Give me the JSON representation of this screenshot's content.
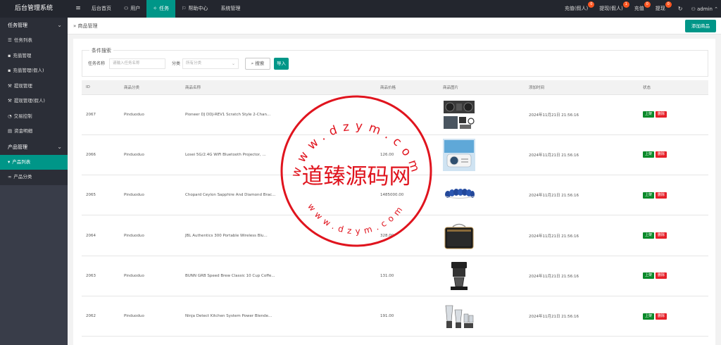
{
  "app": {
    "title": "后台管理系统"
  },
  "topnav": {
    "items": [
      {
        "label": "后台首页",
        "icon": "home-icon"
      },
      {
        "label": "用户",
        "icon": "user-icon"
      },
      {
        "label": "任务",
        "icon": "run-icon"
      },
      {
        "label": "帮助中心",
        "icon": "flag-icon"
      },
      {
        "label": "系统管理",
        "icon": ""
      }
    ],
    "active": "任务",
    "right": [
      {
        "label": "充值(假人)",
        "badge": "0"
      },
      {
        "label": "提现(假人)",
        "badge": "1"
      },
      {
        "label": "充值",
        "badge": "0"
      },
      {
        "label": "提现",
        "badge": "0"
      }
    ],
    "user": "admin"
  },
  "sidebar": {
    "group1": "任务管理",
    "items": [
      "任务列表",
      "充值管理",
      "充值管理(假人)",
      "提现管理",
      "提现管理(假人)",
      "交易控制",
      "资金明细"
    ],
    "group2": "产品管理",
    "items2": [
      "产品列表",
      "产品分类"
    ]
  },
  "breadcrumb": "商品管理",
  "add_button": "添加商品",
  "search": {
    "legend": "条件搜索",
    "name_label": "任务名称",
    "name_placeholder": "请输入任务名称",
    "category_label": "分类",
    "category_placeholder": "所有分类",
    "search_button": "搜索",
    "import_button": "导入"
  },
  "table": {
    "headers": [
      "ID",
      "商品分类",
      "商品名称",
      "商品价格",
      "商品图片",
      "添加时间",
      "状态"
    ],
    "rows": [
      {
        "id": "2067",
        "category": "Pinduoduo",
        "name": "Pioneer DJ DDJ-REV1 Scratch Style 2-Chan...",
        "price": "",
        "time": "2024年11月21日 21:56:16"
      },
      {
        "id": "2066",
        "category": "Pinduoduo",
        "name": "Losei 5G/2.4G WiFi Bluetooth Projector, ...",
        "price": "126.00",
        "time": "2024年11月21日 21:56:16"
      },
      {
        "id": "2065",
        "category": "Pinduoduo",
        "name": "Chopard Ceylon Sapphire And Diamond Brac...",
        "price": "1485000.00",
        "time": "2024年11月21日 21:56:16"
      },
      {
        "id": "2064",
        "category": "Pinduoduo",
        "name": "JBL Authentics 300 Portable Wireless Blu...",
        "price": "328.00",
        "time": "2024年11月21日 21:56:16"
      },
      {
        "id": "2063",
        "category": "Pinduoduo",
        "name": "BUNN GRB Speed Brew Classic 10 Cup Coffe...",
        "price": "131.00",
        "time": "2024年11月21日 21:56:16"
      },
      {
        "id": "2062",
        "category": "Pinduoduo",
        "name": "Ninja Detect Kitchen System Power Blende...",
        "price": "191.00",
        "time": "2024年11月21日 21:56:16"
      }
    ],
    "action_on": "上架",
    "action_del": "删除"
  },
  "watermark": {
    "main": "道臻源码网",
    "url": "www.dzym.com"
  },
  "colors": {
    "accent": "#009688",
    "topbar": "#23262e",
    "sidebar": "#393d49",
    "stamp": "#e0141e"
  }
}
